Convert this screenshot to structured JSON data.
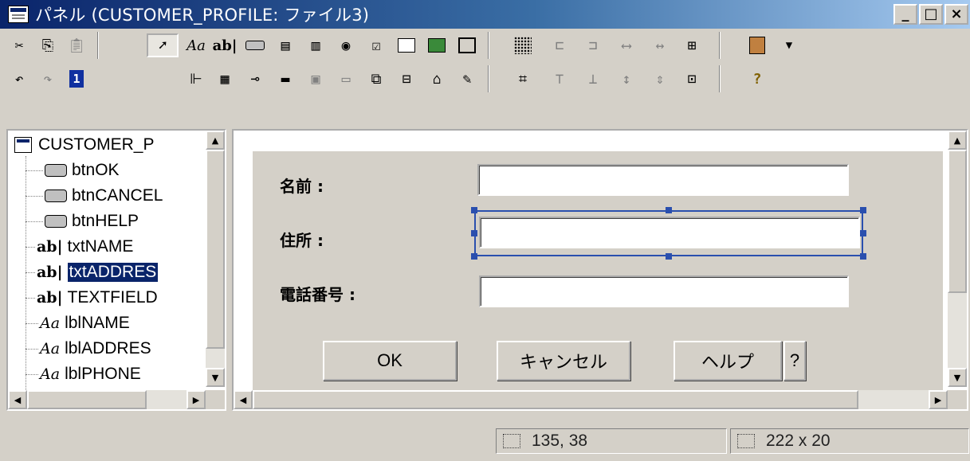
{
  "window": {
    "title": "パネル (CUSTOMER_PROFILE: ファイル3)",
    "minimize": "_",
    "maximize": "□",
    "close": "×"
  },
  "toolbar1": {
    "tools": [
      "scissors-icon",
      "copy-icon",
      "paste-icon",
      "pointer-icon",
      "label-tool-icon",
      "textfield-tool-icon",
      "button-tool-icon",
      "listbox-tool-icon",
      "combobox-tool-icon",
      "radio-tool-icon",
      "checkbox-tool-icon",
      "spinner-tool-icon",
      "image-tool-icon",
      "chart-tool-icon",
      "grid-icon",
      "align-left-icon",
      "align-right-icon",
      "same-width-icon",
      "spacing-icon",
      "center-horizontal-icon",
      "properties-icon",
      "dropdown-arrow-icon"
    ],
    "label_tool_text": "Aa",
    "textfield_tool_text": "ab|"
  },
  "toolbar2": {
    "tools": [
      "undo-icon",
      "redo-icon",
      "tab-order-icon",
      "tree-icon",
      "table-icon",
      "slider-icon",
      "progress-icon",
      "textarea-icon",
      "scrollbar-icon",
      "menu-icon",
      "status-tool-icon",
      "tab-tool-icon",
      "edit-icon",
      "resize-icon",
      "align-top-icon",
      "align-bottom-icon",
      "same-height-icon",
      "vertical-spacing-icon",
      "center-vertical-icon",
      "help-icon"
    ],
    "tab_order_text": "1",
    "help_text": "?"
  },
  "tree": {
    "root": "CUSTOMER_P",
    "items": [
      {
        "type": "button",
        "label": "btnOK"
      },
      {
        "type": "button",
        "label": "btnCANCEL"
      },
      {
        "type": "button",
        "label": "btnHELP"
      },
      {
        "type": "textfield",
        "label": "txtNAME"
      },
      {
        "type": "textfield",
        "label": "txtADDRES",
        "selected": true
      },
      {
        "type": "textfield",
        "label": "TEXTFIELD"
      },
      {
        "type": "label",
        "label": "lblNAME"
      },
      {
        "type": "label",
        "label": "lblADDRES"
      },
      {
        "type": "label",
        "label": "lblPHONE"
      }
    ],
    "text_icon": "ab|",
    "label_icon": "Aa"
  },
  "form": {
    "name_label": "名前 :",
    "address_label": "住所 :",
    "phone_label": "電話番号 :",
    "name_value": "",
    "address_value": "",
    "phone_value": "",
    "ok_button": "OK",
    "cancel_button": "キャンセル",
    "help_button": "ヘルプ",
    "question_button": "?"
  },
  "status": {
    "position": "135, 38",
    "size": "222 x 20"
  }
}
